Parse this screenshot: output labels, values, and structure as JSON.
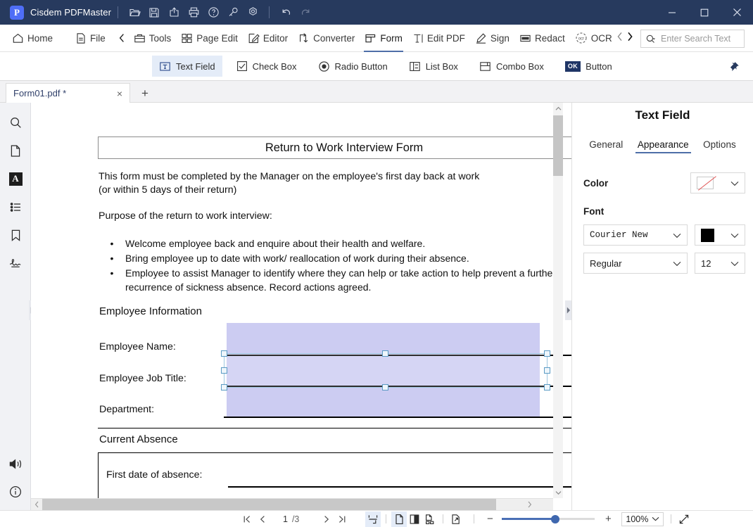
{
  "window": {
    "app_name": "Cisdem PDFMaster",
    "logo_letter": "P",
    "quick_actions": [
      "open-folder-icon",
      "save-icon",
      "share-icon",
      "print-icon",
      "help-icon",
      "key-icon",
      "settings-icon"
    ],
    "undo_label": "undo-icon",
    "redo_label": "redo-icon",
    "controls": [
      "minimize",
      "maximize",
      "close"
    ]
  },
  "ribbon": {
    "items": [
      {
        "label": "Home",
        "icon": "home-icon",
        "active": false
      },
      {
        "label": "File",
        "icon": "file-icon",
        "active": false
      },
      {
        "label": "Tools",
        "icon": "toolbox-icon",
        "active": false
      },
      {
        "label": "Page Edit",
        "icon": "grid-icon",
        "active": false
      },
      {
        "label": "Editor",
        "icon": "pencil-square-icon",
        "active": false
      },
      {
        "label": "Converter",
        "icon": "convert-arrows-icon",
        "active": false
      },
      {
        "label": "Form",
        "icon": "form-icon",
        "active": true
      },
      {
        "label": "Edit PDF",
        "icon": "text-t-icon",
        "active": false
      },
      {
        "label": "Sign",
        "icon": "pen-nib-icon",
        "active": false
      },
      {
        "label": "Redact",
        "icon": "redact-bar-icon",
        "active": false
      },
      {
        "label": "OCR",
        "icon": "ocr-circle-icon",
        "active": false
      }
    ],
    "left_chevron": "chevron-left-icon",
    "nav_prev": "chevron-left-icon",
    "nav_next": "chevron-right-icon"
  },
  "search": {
    "placeholder": "Enter Search Text",
    "value": "",
    "icon": "search-dropdown-icon"
  },
  "form_toolbar": {
    "tools": [
      {
        "label": "Text Field",
        "icon": "text-field-icon",
        "selected": true
      },
      {
        "label": "Check Box",
        "icon": "check-box-icon",
        "selected": false
      },
      {
        "label": "Radio Button",
        "icon": "radio-button-icon",
        "selected": false
      },
      {
        "label": "List Box",
        "icon": "list-box-icon",
        "selected": false
      },
      {
        "label": "Combo Box",
        "icon": "combo-box-icon",
        "selected": false
      },
      {
        "label": "Button",
        "icon": "ok-button-icon",
        "selected": false
      }
    ],
    "pin": "pin-icon"
  },
  "tabs": {
    "documents": [
      {
        "title": "Form01.pdf *",
        "close": "×",
        "active": true
      }
    ],
    "new_tab": "+"
  },
  "rail": {
    "items": [
      {
        "name": "search",
        "icon": "search-icon",
        "selected": false
      },
      {
        "name": "thumbnails",
        "icon": "page-icon",
        "selected": false
      },
      {
        "name": "annotations",
        "icon": "letter-a-icon",
        "selected": true,
        "glyph": "A"
      },
      {
        "name": "outline",
        "icon": "list-icon",
        "selected": false
      },
      {
        "name": "bookmarks",
        "icon": "bookmark-icon",
        "selected": false
      },
      {
        "name": "signatures",
        "icon": "signature-icon",
        "selected": false
      }
    ],
    "bottom": [
      {
        "name": "read-aloud",
        "icon": "speaker-icon"
      },
      {
        "name": "info",
        "icon": "info-icon"
      }
    ]
  },
  "document": {
    "title": "Return to Work Interview Form",
    "intro_line1": "This form must be completed by the Manager on the employee's first day back at work",
    "intro_line2": "(or within 5 days of their return)",
    "purpose": "Purpose of the return to work interview:",
    "bullet_char": "•",
    "bullets": [
      "Welcome employee back and enquire about their health and welfare.",
      "Bring employee up to date with work/ reallocation of work during their absence.",
      "Employee to assist Manager to identify where they can help or take action to help prevent a further recurrence of sickness absence. Record actions agreed."
    ],
    "section_employee": "Employee Information",
    "fields": [
      {
        "label": "Employee Name:",
        "value": "",
        "selected": false
      },
      {
        "label": "Employee Job Title:",
        "value": "",
        "selected": true
      },
      {
        "label": "Department:",
        "value": "",
        "selected": false
      }
    ],
    "section_absence": "Current Absence",
    "absence_field": {
      "label": "First date of absence:",
      "value": ""
    },
    "field_highlight_color": "#ccccf2",
    "selection_color": "#5b9bc4"
  },
  "properties": {
    "title": "Text Field",
    "tabs": [
      {
        "label": "General",
        "active": false
      },
      {
        "label": "Appearance",
        "active": true
      },
      {
        "label": "Options",
        "active": false
      }
    ],
    "color": {
      "label": "Color",
      "value": "None",
      "swatch": "no-color-icon",
      "chevron": "chevron-down-icon"
    },
    "font": {
      "label": "Font",
      "family": "Courier New",
      "color_swatch": "#000000",
      "style": "Regular",
      "size": "12"
    }
  },
  "status": {
    "first_page": "first-page-icon",
    "prev_page": "prev-page-icon",
    "current_page": "1",
    "page_total": "/3",
    "next_page": "next-page-icon",
    "last_page": "last-page-icon",
    "view_modes": [
      {
        "name": "fit-page",
        "icon": "fit-page-icon",
        "selected": true
      },
      {
        "name": "single-page",
        "icon": "single-page-icon",
        "selected": true
      },
      {
        "name": "two-page",
        "icon": "two-page-icon",
        "selected": false
      },
      {
        "name": "continuous-page",
        "icon": "continuous-page-icon",
        "selected": false
      },
      {
        "name": "crop-page",
        "icon": "crop-page-icon",
        "selected": false
      }
    ],
    "zoom_out": "−",
    "zoom_in": "+",
    "zoom_value": "100%",
    "zoom_chevron": "chevron-down-icon",
    "fullscreen": "fullscreen-icon",
    "zoom_percent": 100
  }
}
